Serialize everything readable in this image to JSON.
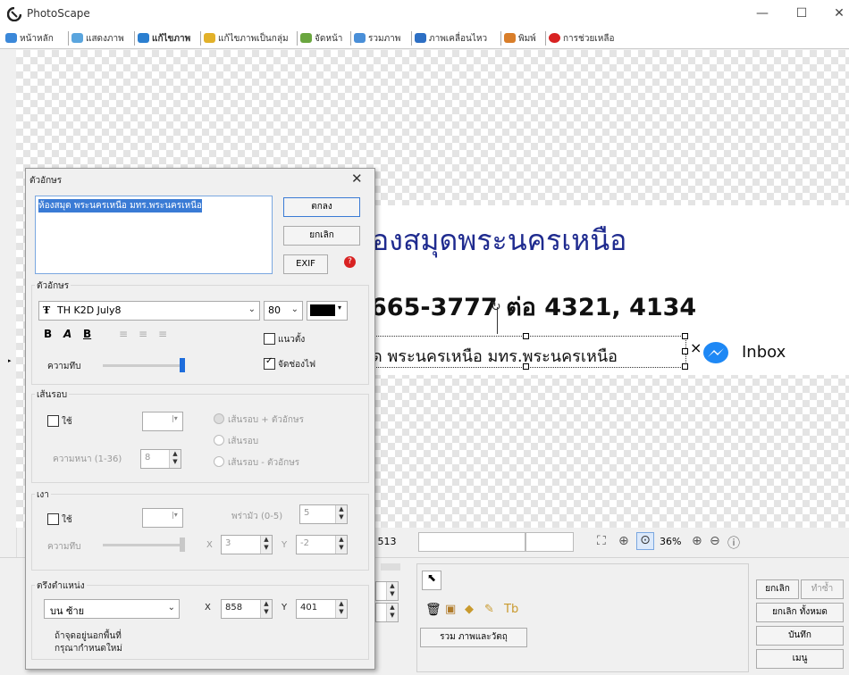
{
  "app": {
    "title": "PhotoScape"
  },
  "tabs": [
    {
      "label": "หน้าหลัก",
      "color": "#3b88d9"
    },
    {
      "label": "แสดงภาพ",
      "color": "#5aa5de"
    },
    {
      "label": "แก้ไขภาพ",
      "color": "#2b7fd0"
    },
    {
      "label": "แก้ไขภาพเป็นกลุ่ม",
      "color": "#e2b12a"
    },
    {
      "label": "จัดหน้า",
      "color": "#6aa63f"
    },
    {
      "label": "รวมภาพ",
      "color": "#4a8fd8"
    },
    {
      "label": "ภาพเคลื่อนไหว",
      "color": "#2d6fc4"
    },
    {
      "label": "พิมพ์",
      "color": "#d97e2a"
    },
    {
      "label": "การช่วยเหลือ",
      "color": "#d82222"
    }
  ],
  "canvas": {
    "line1": "องสมุดพระนครเหนือ",
    "line2": "665-3777 ต่อ 4321, 4134",
    "line3": "ุด พระนครเหนือ มทร.พระนครเหนือ",
    "inbox": "Inbox",
    "close_glyph": "×"
  },
  "status": {
    "size": "0 x 513",
    "zoom": "36%"
  },
  "bottom": {
    "combine_label": "รวม ภาพและวัตถุ",
    "undo_label": "ยกเลิก",
    "redo_label": "ทำซ้ำ",
    "undo_all_label": "ยกเลิก ทั้งหมด",
    "save_label": "บันทึก",
    "menu_label": "เมนู"
  },
  "dialog": {
    "title": "ตัวอักษร",
    "text_value": "ห้องสมุด พระนครเหนือ มทร.พระนครเหนือ",
    "ok_label": "ตกลง",
    "cancel_label": "ยกเลิก",
    "exif_label": "EXIF",
    "font_group": "ตัวอักษร",
    "font_name": "TH K2D July8",
    "font_size": "80",
    "font_color": "#000000",
    "vertical_label": "แนวตั้ง",
    "antialias_label": "จัดช่องไฟ",
    "opacity_label": "ความทึบ",
    "opacity_value": 1.0,
    "outline_group": "เส้นรอบ",
    "outline_use": "ใช้",
    "outline_opt1": "เส้นรอบ + ตัวอักษร",
    "outline_opt2": "เส้นรอบ",
    "outline_opt3": "เส้นรอบ - ตัวอักษร",
    "thickness_label": "ความหนา (1-36)",
    "thickness_value": "8",
    "shadow_group": "เงา",
    "shadow_use": "ใช้",
    "blur_label": "พร่ามัว (0-5)",
    "blur_value": "5",
    "shadow_opacity_label": "ความทึบ",
    "shadow_x_label": "X",
    "shadow_x_value": "3",
    "shadow_y_label": "Y",
    "shadow_y_value": "-2",
    "position_group": "ตรึงตำแหน่ง",
    "position_value": "บน ซ้าย",
    "pos_x_label": "X",
    "pos_x_value": "858",
    "pos_y_label": "Y",
    "pos_y_value": "401",
    "hint_line1": "ถ้าจุดอยู่นอกพื้นที่",
    "hint_line2": "กรุณากำหนดใหม่"
  }
}
